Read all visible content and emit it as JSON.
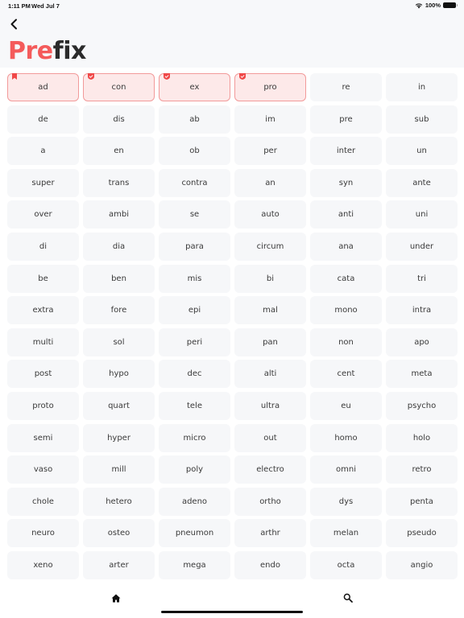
{
  "status_bar": {
    "time": "1:11 PM",
    "date": "Wed Jul 7",
    "battery": "100%",
    "wifi_icon": "wifi-icon",
    "battery_icon": "battery-icon"
  },
  "header": {
    "back_icon": "chevron-left-icon",
    "title_accent": "Pre",
    "title_rest": "fix"
  },
  "colors": {
    "accent": "#f45b5b",
    "selected_bg": "#fde9e9",
    "selected_border": "#f29a9a",
    "cell_bg": "#f6f7f9"
  },
  "prefixes": [
    {
      "label": "ad",
      "selected": true,
      "badge": "bookmark"
    },
    {
      "label": "con",
      "selected": true,
      "badge": "shield-check"
    },
    {
      "label": "ex",
      "selected": true,
      "badge": "shield-check"
    },
    {
      "label": "pro",
      "selected": true,
      "badge": "shield-check"
    },
    {
      "label": "re"
    },
    {
      "label": "in"
    },
    {
      "label": "de"
    },
    {
      "label": "dis"
    },
    {
      "label": "ab"
    },
    {
      "label": "im"
    },
    {
      "label": "pre"
    },
    {
      "label": "sub"
    },
    {
      "label": "a"
    },
    {
      "label": "en"
    },
    {
      "label": "ob"
    },
    {
      "label": "per"
    },
    {
      "label": "inter"
    },
    {
      "label": "un"
    },
    {
      "label": "super"
    },
    {
      "label": "trans"
    },
    {
      "label": "contra"
    },
    {
      "label": "an"
    },
    {
      "label": "syn"
    },
    {
      "label": "ante"
    },
    {
      "label": "over"
    },
    {
      "label": "ambi"
    },
    {
      "label": "se"
    },
    {
      "label": "auto"
    },
    {
      "label": "anti"
    },
    {
      "label": "uni"
    },
    {
      "label": "di"
    },
    {
      "label": "dia"
    },
    {
      "label": "para"
    },
    {
      "label": "circum"
    },
    {
      "label": "ana"
    },
    {
      "label": "under"
    },
    {
      "label": "be"
    },
    {
      "label": "ben"
    },
    {
      "label": "mis"
    },
    {
      "label": "bi"
    },
    {
      "label": "cata"
    },
    {
      "label": "tri"
    },
    {
      "label": "extra"
    },
    {
      "label": "fore"
    },
    {
      "label": "epi"
    },
    {
      "label": "mal"
    },
    {
      "label": "mono"
    },
    {
      "label": "intra"
    },
    {
      "label": "multi"
    },
    {
      "label": "sol"
    },
    {
      "label": "peri"
    },
    {
      "label": "pan"
    },
    {
      "label": "non"
    },
    {
      "label": "apo"
    },
    {
      "label": "post"
    },
    {
      "label": "hypo"
    },
    {
      "label": "dec"
    },
    {
      "label": "alti"
    },
    {
      "label": "cent"
    },
    {
      "label": "meta"
    },
    {
      "label": "proto"
    },
    {
      "label": "quart"
    },
    {
      "label": "tele"
    },
    {
      "label": "ultra"
    },
    {
      "label": "eu"
    },
    {
      "label": "psycho"
    },
    {
      "label": "semi"
    },
    {
      "label": "hyper"
    },
    {
      "label": "micro"
    },
    {
      "label": "out"
    },
    {
      "label": "homo"
    },
    {
      "label": "holo"
    },
    {
      "label": "vaso"
    },
    {
      "label": "mill"
    },
    {
      "label": "poly"
    },
    {
      "label": "electro"
    },
    {
      "label": "omni"
    },
    {
      "label": "retro"
    },
    {
      "label": "chole"
    },
    {
      "label": "hetero"
    },
    {
      "label": "adeno"
    },
    {
      "label": "ortho"
    },
    {
      "label": "dys"
    },
    {
      "label": "penta"
    },
    {
      "label": "neuro"
    },
    {
      "label": "osteo"
    },
    {
      "label": "pneumon"
    },
    {
      "label": "arthr"
    },
    {
      "label": "melan"
    },
    {
      "label": "pseudo"
    },
    {
      "label": "xeno"
    },
    {
      "label": "arter"
    },
    {
      "label": "mega"
    },
    {
      "label": "endo"
    },
    {
      "label": "octa"
    },
    {
      "label": "angio"
    }
  ],
  "bottom_nav": {
    "items": [
      {
        "name": "home",
        "icon": "home-icon"
      },
      {
        "name": "search",
        "icon": "search-icon"
      }
    ]
  }
}
